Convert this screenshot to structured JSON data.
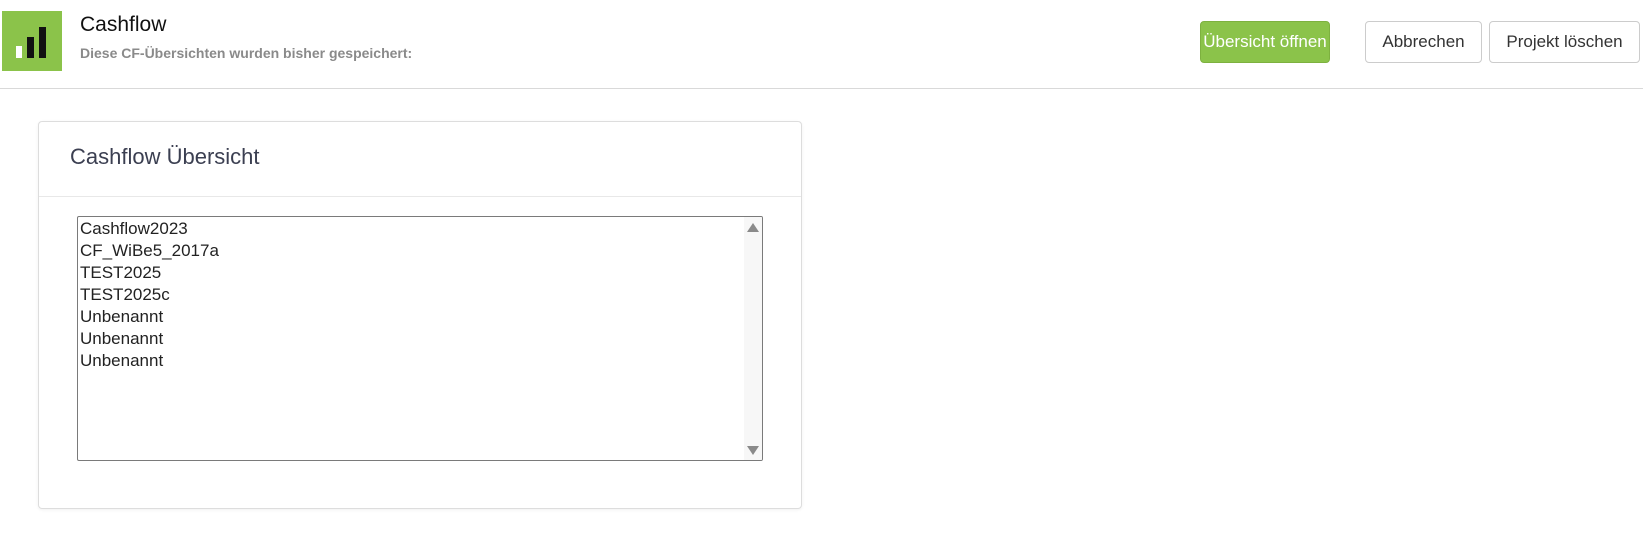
{
  "header": {
    "title": "Cashflow",
    "subtitle": "Diese CF-Übersichten wurden bisher gespeichert:",
    "logo_icon": "bar-chart-icon",
    "accent_color": "#8bc34a"
  },
  "toolbar": {
    "open_label": "Übersicht öffnen",
    "cancel_label": "Abbrechen",
    "delete_label": "Projekt löschen"
  },
  "panel": {
    "title": "Cashflow Übersicht",
    "items": [
      {
        "label": "Cashflow2023"
      },
      {
        "label": "CF_WiBe5_2017a"
      },
      {
        "label": "TEST2025"
      },
      {
        "label": "TEST2025c"
      },
      {
        "label": "Unbenannt"
      },
      {
        "label": "Unbenannt"
      },
      {
        "label": "Unbenannt"
      }
    ]
  }
}
